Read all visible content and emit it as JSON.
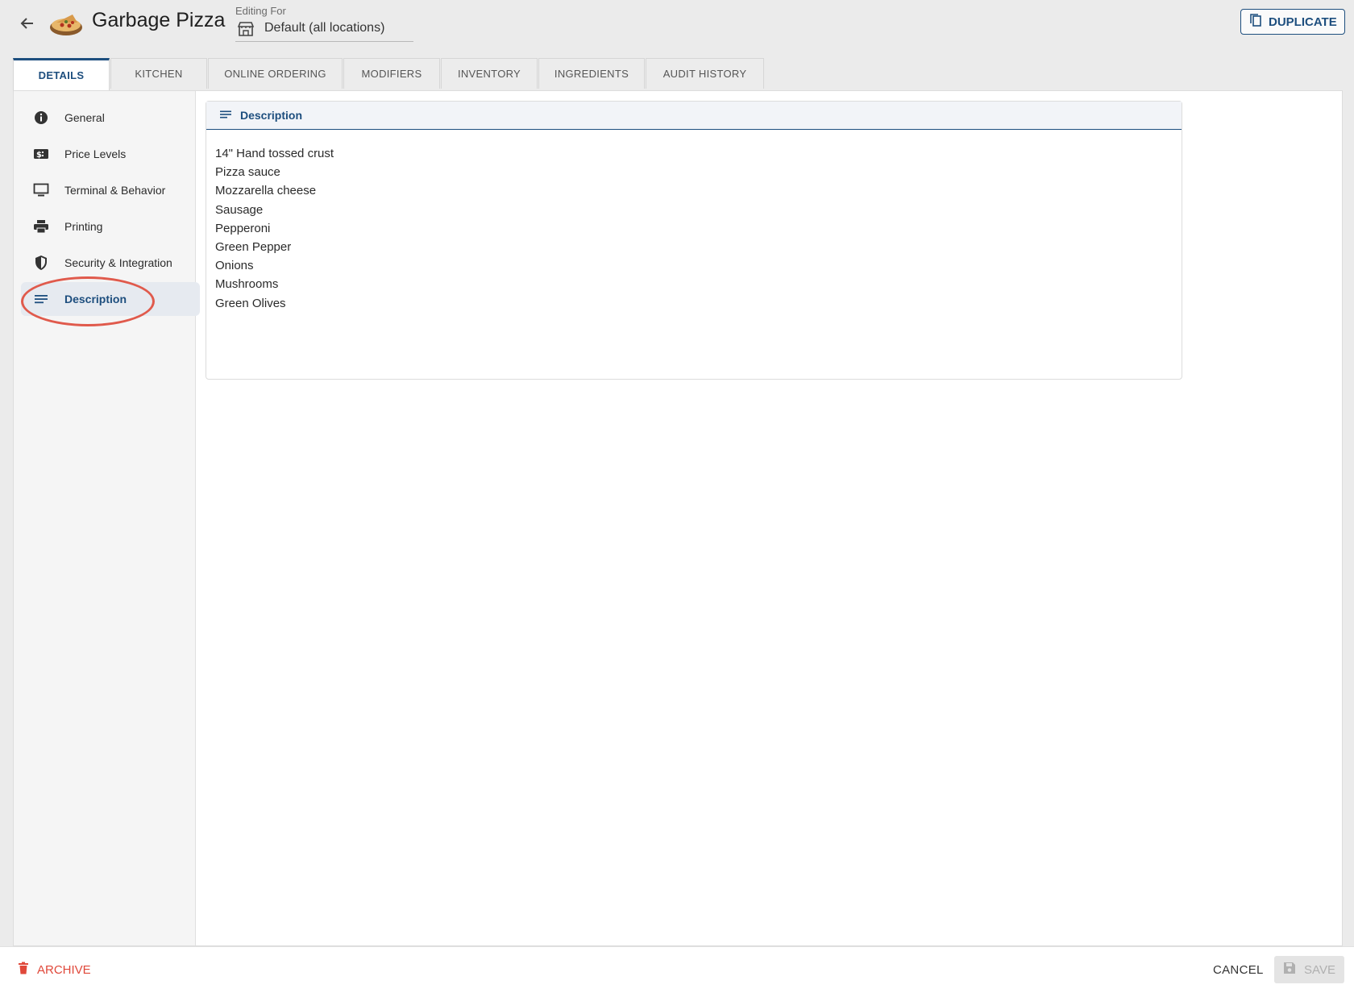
{
  "header": {
    "title": "Garbage Pizza",
    "editing_label": "Editing For",
    "editing_value": "Default (all locations)",
    "duplicate_label": "DUPLICATE"
  },
  "tabs": [
    {
      "label": "DETAILS",
      "active": true
    },
    {
      "label": "KITCHEN"
    },
    {
      "label": "ONLINE ORDERING"
    },
    {
      "label": "MODIFIERS"
    },
    {
      "label": "INVENTORY"
    },
    {
      "label": "INGREDIENTS"
    },
    {
      "label": "AUDIT HISTORY"
    }
  ],
  "sidebar": {
    "items": [
      {
        "label": "General",
        "icon": "info-icon"
      },
      {
        "label": "Price Levels",
        "icon": "price-tag-icon"
      },
      {
        "label": "Terminal & Behavior",
        "icon": "monitor-icon"
      },
      {
        "label": "Printing",
        "icon": "printer-icon"
      },
      {
        "label": "Security & Integration",
        "icon": "shield-icon"
      },
      {
        "label": "Description",
        "icon": "lines-icon",
        "active": true
      }
    ]
  },
  "card": {
    "title": "Description",
    "lines": [
      "14\" Hand tossed crust",
      "Pizza sauce",
      "Mozzarella cheese",
      "Sausage",
      "Pepperoni",
      "Green Pepper",
      "Onions",
      "Mushrooms",
      "Green Olives"
    ]
  },
  "footer": {
    "archive_label": "ARCHIVE",
    "cancel_label": "CANCEL",
    "save_label": "SAVE"
  },
  "colors": {
    "accent": "#1d4e7e",
    "danger": "#e0483a",
    "highlight_circle": "#e05a4c"
  }
}
